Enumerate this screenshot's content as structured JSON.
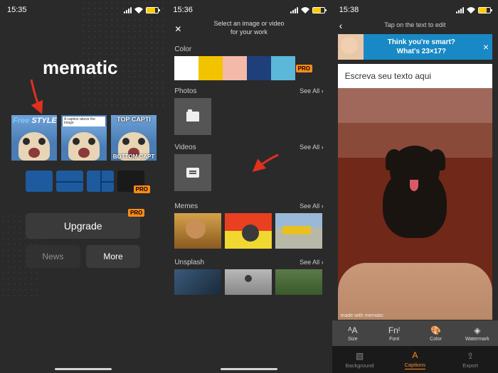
{
  "screen1": {
    "time": "15:35",
    "app_title": "mematic",
    "templates": {
      "free_label_1": "Free",
      "free_label_2": "STYLE",
      "caption_label": "A caption above the image",
      "top_caption": "TOP CAPTI",
      "bottom_caption": "BOTTOM CAPT"
    },
    "pro_badge": "PRO",
    "upgrade_label": "Upgrade",
    "news_label": "News",
    "more_label": "More"
  },
  "screen2": {
    "time": "15:36",
    "header_line1": "Select an image or video",
    "header_line2": "for your work",
    "close": "✕",
    "sections": {
      "color": "Color",
      "photos": "Photos",
      "videos": "Videos",
      "memes": "Memes",
      "unsplash": "Unsplash"
    },
    "see_all": "See All",
    "pro_badge": "PRO"
  },
  "screen3": {
    "time": "15:38",
    "header": "Tap on the text to edit",
    "back": "‹",
    "ad": {
      "line1": "Think you're smart?",
      "line2": "What's 23×17?",
      "close": "×"
    },
    "placeholder_text": "Escreva seu texto aqui",
    "watermark": "made with mematic",
    "tools": {
      "size": "Size",
      "font": "Font",
      "color": "Color",
      "watermark": "Watermark"
    },
    "tabs": {
      "background": "Background",
      "captions": "Captions",
      "export": "Export"
    }
  }
}
